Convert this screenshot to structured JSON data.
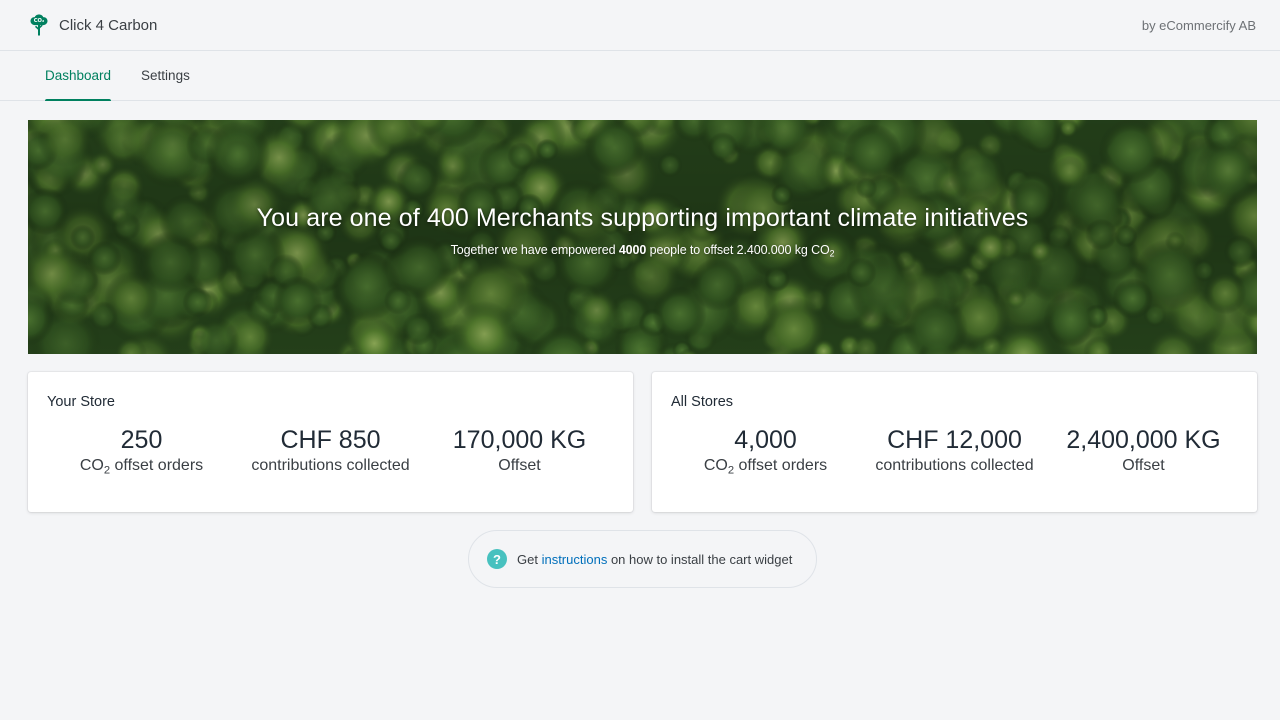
{
  "app": {
    "name": "Click 4 Carbon",
    "logo_text": "CO₂",
    "byline": "by eCommercify AB",
    "accent_color": "#00805f"
  },
  "tabs": [
    {
      "label": "Dashboard",
      "active": true
    },
    {
      "label": "Settings",
      "active": false
    }
  ],
  "hero": {
    "title": "You are one of 400 Merchants supporting important climate initiatives",
    "subtitle_prefix": "Together we have empowered",
    "people_count": "4000",
    "subtitle_mid": "people to offset 2.400.000 kg CO",
    "subtitle_sub": "2"
  },
  "your_store": {
    "title": "Your Store",
    "orders_value": "250",
    "orders_label_prefix": "CO",
    "orders_label_sub": "2",
    "orders_label_suffix": " offset orders",
    "contributions_value": "CHF 850",
    "contributions_label": "contributions collected",
    "offset_value": "170,000 KG",
    "offset_label": "Offset"
  },
  "all_stores": {
    "title": "All Stores",
    "orders_value": "4,000",
    "orders_label_prefix": "CO",
    "orders_label_sub": "2",
    "orders_label_suffix": " offset orders",
    "contributions_value": "CHF 12,000",
    "contributions_label": "contributions collected",
    "offset_value": "2,400,000 KG",
    "offset_label": "Offset"
  },
  "help": {
    "icon": "question-circle-icon",
    "prefix": "Get ",
    "link_text": "instructions",
    "suffix": " on how to install the cart widget"
  }
}
